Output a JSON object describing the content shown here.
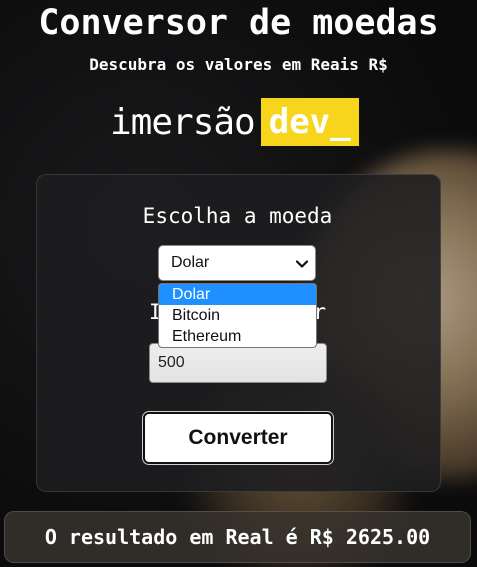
{
  "header": {
    "title": "Conversor de moedas",
    "subtitle": "Descubra os valores em Reais R$"
  },
  "logo": {
    "text": "imersão",
    "badge": "dev_",
    "badge_color": "#f7d51d"
  },
  "form": {
    "choose_label": "Escolha a moeda",
    "select": {
      "selected": "Dolar",
      "options": [
        "Dolar",
        "Bitcoin",
        "Ethereum"
      ],
      "dropdown_icon": "chevron-down-icon"
    },
    "input_label": "Insira o valor",
    "value": "500",
    "convert_label": "Converter"
  },
  "result": {
    "text": "O resultado em Real é R$ 2625.00"
  },
  "colors": {
    "background": "#0b0b0c",
    "option_highlight": "#1e90ff"
  }
}
